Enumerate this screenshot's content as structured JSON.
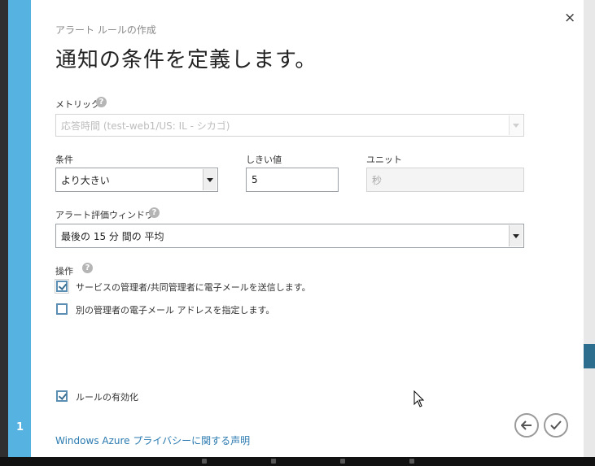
{
  "dialog": {
    "subtitle": "アラート ルールの作成",
    "title": "通知の条件を定義します。",
    "close_glyph": "×",
    "step": "1"
  },
  "metric": {
    "label": "メトリック",
    "value": "応答時間 (test-web1/US: IL - シカゴ)"
  },
  "condition": {
    "label": "条件",
    "value": "より大きい"
  },
  "threshold": {
    "label": "しきい値",
    "value": "5"
  },
  "unit": {
    "label": "ユニット",
    "value": "秒"
  },
  "window": {
    "label": "アラート評価ウィンドウ",
    "value": "最後の 15 分 間の 平均"
  },
  "actions": {
    "label": "操作",
    "email_admins": {
      "label": "サービスの管理者/共同管理者に電子メールを送信します。",
      "checked": true
    },
    "email_other": {
      "label": "別の管理者の電子メール アドレスを指定します。",
      "checked": false
    }
  },
  "enable_rule": {
    "label": "ルールの有効化",
    "checked": true
  },
  "footer": {
    "privacy_link": "Windows Azure プライバシーに関する声明"
  },
  "colors": {
    "rail": "#56b2e0",
    "link": "#2a7ab0",
    "checkbox": "#5a8fb3"
  },
  "icons": {
    "help": "help-icon",
    "back": "arrow-left-icon",
    "confirm": "checkmark-icon"
  }
}
